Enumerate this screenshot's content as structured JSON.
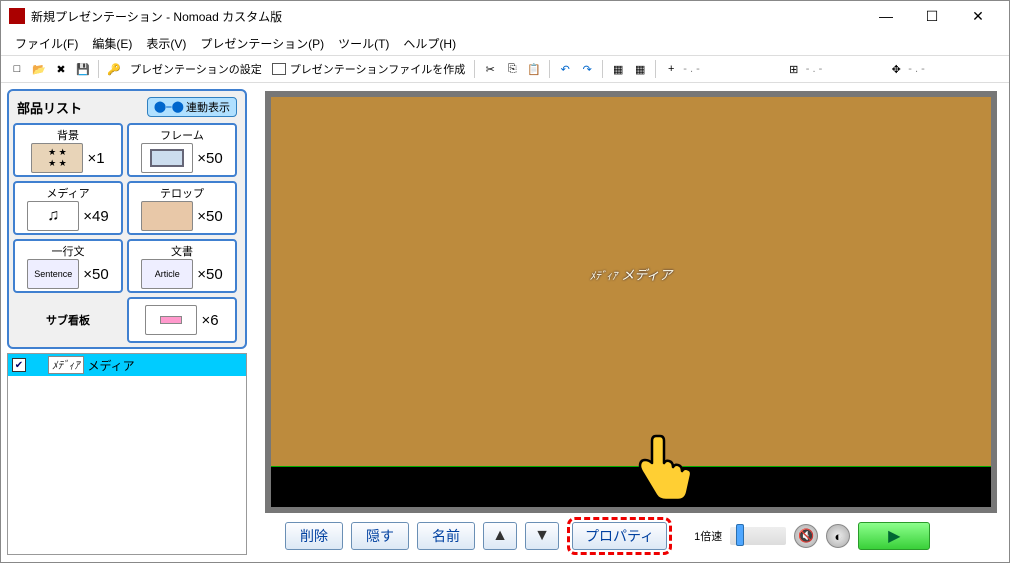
{
  "window": {
    "title": "新規プレゼンテーション - Nomoad カスタム版",
    "min": "—",
    "max": "☐",
    "close": "✕"
  },
  "menu": {
    "file": "ファイル(F)",
    "edit": "編集(E)",
    "view": "表示(V)",
    "presentation": "プレゼンテーション(P)",
    "tool": "ツール(T)",
    "help": "ヘルプ(H)"
  },
  "toolbar": {
    "settings_label": "プレゼンテーションの設定",
    "makefile_label": "プレゼンテーションファイルを作成",
    "dash1": "- . -",
    "dash2": "- . -",
    "dash3": "- . -"
  },
  "parts": {
    "panel_title": "部品リスト",
    "link_label": "連動表示",
    "items": [
      {
        "label": "背景",
        "thumb": "stars",
        "count": "×1"
      },
      {
        "label": "フレーム",
        "thumb": "frame",
        "count": "×50"
      },
      {
        "label": "メディア",
        "thumb": "note",
        "count": "×49"
      },
      {
        "label": "テロップ",
        "thumb": "texture",
        "count": "×50"
      },
      {
        "label": "一行文",
        "thumb": "Sentence",
        "count": "×50"
      },
      {
        "label": "文書",
        "thumb": "Article",
        "count": "×50"
      },
      {
        "label": "サブ看板",
        "thumb": "",
        "count": ""
      },
      {
        "label": "",
        "thumb": "sign",
        "count": "×6"
      }
    ]
  },
  "list": {
    "items": [
      {
        "tag": "ﾒﾃﾞｨｱ",
        "name": "メディア"
      }
    ]
  },
  "canvas": {
    "tag_small": "ﾒﾃﾞｨｱ",
    "tag_big": "メディア"
  },
  "bottom": {
    "delete": "削除",
    "hide": "隠す",
    "name": "名前",
    "up": "▲",
    "down": "▼",
    "properties": "プロパティ",
    "speed_label": "1倍速",
    "play": "▶"
  },
  "icons": {
    "new": "□",
    "open": "📂",
    "close": "✖",
    "save": "💾",
    "key": "🔑",
    "cut": "✂",
    "copy": "⎘",
    "paste": "📋",
    "undo": "↶",
    "redo": "↷",
    "grid1": "▦",
    "grid2": "▦",
    "plus": "+",
    "boxplus": "⊞",
    "move": "✥",
    "mute": "🔇",
    "globe": "◐"
  }
}
